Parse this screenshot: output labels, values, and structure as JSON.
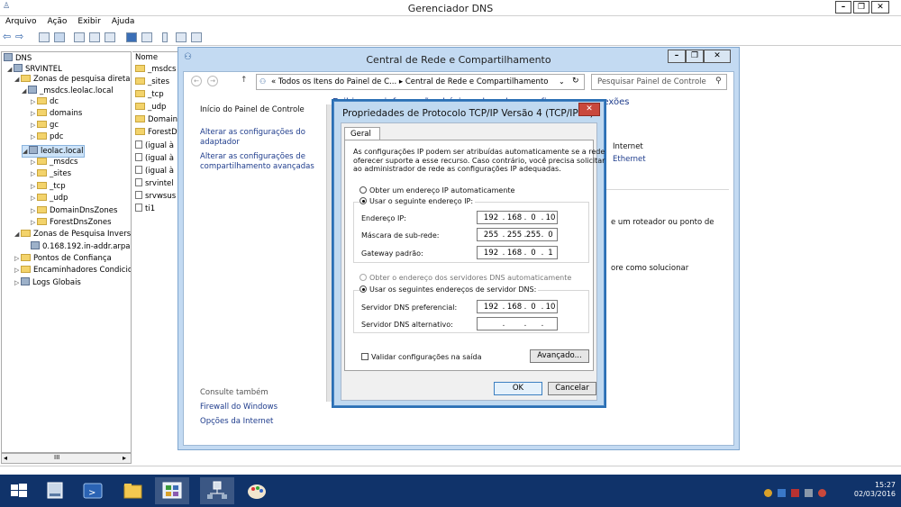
{
  "dns_window": {
    "title": "Gerenciador DNS",
    "menu": [
      "Arquivo",
      "Ação",
      "Exibir",
      "Ajuda"
    ],
    "controls": {
      "minimize": "–",
      "restore": "❐",
      "close": "✕"
    }
  },
  "tree": {
    "root": "DNS",
    "server": "SRVINTEL",
    "items": [
      {
        "label": "Zonas de pesquisa direta",
        "level": 1
      },
      {
        "label": "_msdcs.leolac.local",
        "level": 2
      },
      {
        "label": "dc",
        "level": 3
      },
      {
        "label": "domains",
        "level": 3
      },
      {
        "label": "gc",
        "level": 3
      },
      {
        "label": "pdc",
        "level": 3
      },
      {
        "label": "leolac.local",
        "level": 2
      },
      {
        "label": "_msdcs",
        "level": 3
      },
      {
        "label": "_sites",
        "level": 3
      },
      {
        "label": "_tcp",
        "level": 3
      },
      {
        "label": "_udp",
        "level": 3
      },
      {
        "label": "DomainDnsZones",
        "level": 3
      },
      {
        "label": "ForestDnsZones",
        "level": 3
      },
      {
        "label": "Zonas de Pesquisa Inversa",
        "level": 1
      },
      {
        "label": "0.168.192.in-addr.arpa",
        "level": 2
      },
      {
        "label": "Pontos de Confiança",
        "level": 1
      },
      {
        "label": "Encaminhadores Condicionais",
        "level": 1
      },
      {
        "label": "Logs Globais",
        "level": 1
      }
    ],
    "scroll_label": "III"
  },
  "list": {
    "header": "Nome",
    "items": [
      "_msdcs",
      "_sites",
      "_tcp",
      "_udp",
      "Domain",
      "ForestDr",
      "(igual à",
      "(igual à",
      "(igual à",
      "srvintel",
      "srvwsus",
      "ti1"
    ]
  },
  "network_center": {
    "title": "Central de Rede e Compartilhamento",
    "address": "« Todos os Itens do Painel de C... ▸ Central de Rede e Compartilhamento",
    "search_placeholder": "Pesquisar Painel de Controle",
    "heading_partial": "Exibir suas informações básicas de rede e configurar as conexões",
    "sidebar": {
      "home": "Início do Painel de Controle",
      "adapter": "Alterar as configurações do adaptador",
      "sharing": "Alterar as configurações de compartilhamento avançadas",
      "see_also": "Consulte também",
      "firewall": "Firewall do Windows",
      "internet": "Opções da Internet"
    },
    "right_texts": {
      "internet": "Internet",
      "ethernet": "Ethernet",
      "router": "e um roteador ou ponto de",
      "solve": "ore como solucionar"
    }
  },
  "tcpip_dialog": {
    "title": "Propriedades de Protocolo TCP/IP Versão 4 (TCP/IPv4)",
    "tab": "Geral",
    "intro": "As configurações IP podem ser atribuídas automaticamente se a rede oferecer suporte a esse recurso. Caso contrário, você precisa solicitar ao administrador de rede as configurações IP adequadas.",
    "intro_lines": [
      "As configurações IP podem ser atribuídas automaticamente se a rede",
      "oferecer suporte a esse recurso. Caso contrário, você precisa solicitar",
      "ao administrador de rede as configurações IP adequadas."
    ],
    "radio_auto_ip": "Obter um endereço IP automaticamente",
    "radio_manual_ip": "Usar o seguinte endereço IP:",
    "ip_label": "Endereço IP:",
    "ip": [
      "192",
      "168",
      "0",
      "10"
    ],
    "mask_label": "Máscara de sub-rede:",
    "mask": [
      "255",
      "255",
      "255",
      "0"
    ],
    "gateway_label": "Gateway padrão:",
    "gateway": [
      "192",
      "168",
      "0",
      "1"
    ],
    "radio_auto_dns": "Obter o endereço dos servidores DNS automaticamente",
    "radio_manual_dns": "Usar os seguintes endereços de servidor DNS:",
    "dns_pref_label": "Servidor DNS preferencial:",
    "dns_pref": [
      "192",
      "168",
      "0",
      "10"
    ],
    "dns_alt_label": "Servidor DNS alternativo:",
    "dns_alt": [
      "",
      "",
      "",
      ""
    ],
    "validate_label": "Validar configurações na saída",
    "advanced": "Avançado...",
    "ok": "OK",
    "cancel": "Cancelar",
    "close": "✕"
  },
  "taskbar": {
    "time": "15:27",
    "date": "02/03/2016"
  },
  "colors": {
    "taskbar": "#10336a",
    "window_frame": "#c3daf2",
    "dialog_close": "#c9483c",
    "link": "#1e3c8c"
  }
}
